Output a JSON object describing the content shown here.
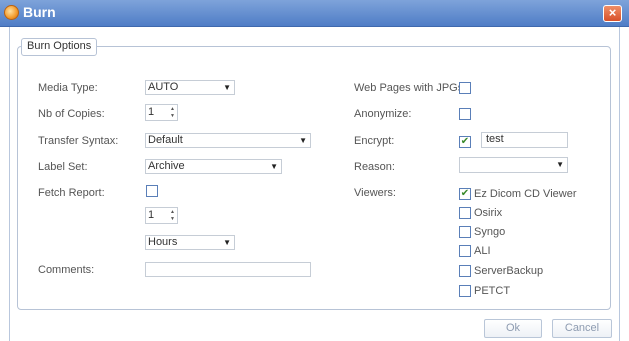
{
  "window": {
    "title": "Burn",
    "close_glyph": "×"
  },
  "group": {
    "label": "Burn Options"
  },
  "left": {
    "media_type": {
      "label": "Media Type:",
      "value": "AUTO"
    },
    "copies": {
      "label": "Nb of Copies:",
      "value": "1"
    },
    "transfer_syntax": {
      "label": "Transfer Syntax:",
      "value": "Default"
    },
    "label_set": {
      "label": "Label Set:",
      "value": "Archive"
    },
    "fetch_report": {
      "label": "Fetch Report:",
      "checked": false
    },
    "fetch_amount": {
      "value": "1"
    },
    "fetch_unit": {
      "value": "Hours"
    },
    "comments": {
      "label": "Comments:",
      "value": ""
    }
  },
  "right": {
    "web_pages": {
      "label": "Web Pages with JPGs:",
      "checked": false
    },
    "anonymize": {
      "label": "Anonymize:",
      "checked": false
    },
    "encrypt": {
      "label": "Encrypt:",
      "checked": true,
      "password": "test"
    },
    "reason": {
      "label": "Reason:",
      "value": ""
    },
    "viewers": {
      "label": "Viewers:",
      "items": [
        {
          "label": "Ez Dicom CD Viewer",
          "checked": true
        },
        {
          "label": "Osirix",
          "checked": false
        },
        {
          "label": "Syngo",
          "checked": false
        },
        {
          "label": "ALI",
          "checked": false
        },
        {
          "label": "ServerBackup",
          "checked": false
        },
        {
          "label": "PETCT",
          "checked": false
        }
      ]
    }
  },
  "buttons": {
    "ok": "Ok",
    "cancel": "Cancel"
  },
  "glyphs": {
    "dropdown": "▼",
    "spin_up": "▲",
    "spin_down": "▼",
    "check": "✔"
  },
  "colors": {
    "title_bar": "#5f8bd0",
    "close_button": "#e06a3f",
    "check_mark": "#3a8a2a"
  }
}
